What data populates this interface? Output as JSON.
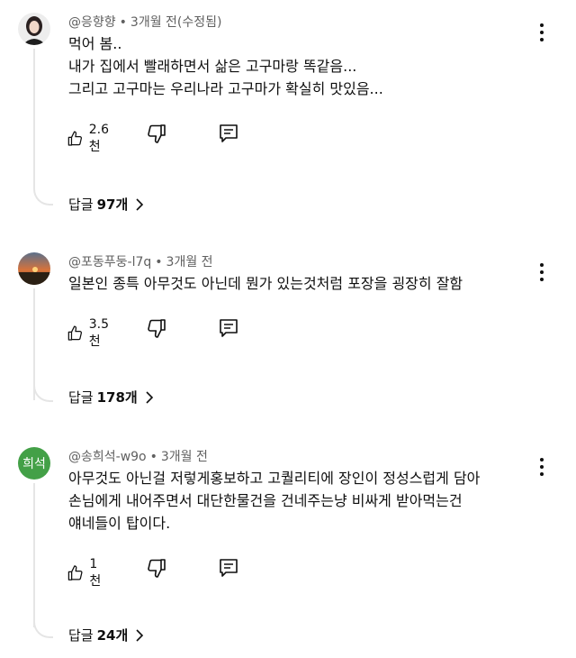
{
  "comments": [
    {
      "author": "@응향향",
      "time": "3개월 전(수정됨)",
      "lines": [
        "먹어 봄..",
        "내가 집에서 빨래하면서 삶은 고구마랑 똑같음...",
        "그리고 고구마는 우리나라 고구마가 확실히 맛있음..."
      ],
      "likes": "2.6천",
      "replies_label": "답글",
      "replies_count": "97개",
      "avatar": "photo"
    },
    {
      "author": "@포동푸둥-l7q",
      "time": "3개월 전",
      "lines": [
        "일본인 종특 아무것도 아닌데 뭔가 있는것처럼 포장을 굉장히 잘함"
      ],
      "likes": "3.5천",
      "replies_label": "답글",
      "replies_count": "178개",
      "avatar": "photo"
    },
    {
      "author": "@송희석-w9o",
      "time": "3개월 전",
      "lines": [
        "아무것도 아닌걸 저렇게홍보하고 고퀄리티에 장인이 정성스럽게 담아",
        "손님에게 내어주면서 대단한물건을 건네주는냥 비싸게 받아먹는건",
        "얘네들이 탑이다."
      ],
      "likes": "1천",
      "replies_label": "답글",
      "replies_count": "24개",
      "avatar": "letter",
      "avatar_text": "희석",
      "avatar_color": "#43a047"
    }
  ]
}
